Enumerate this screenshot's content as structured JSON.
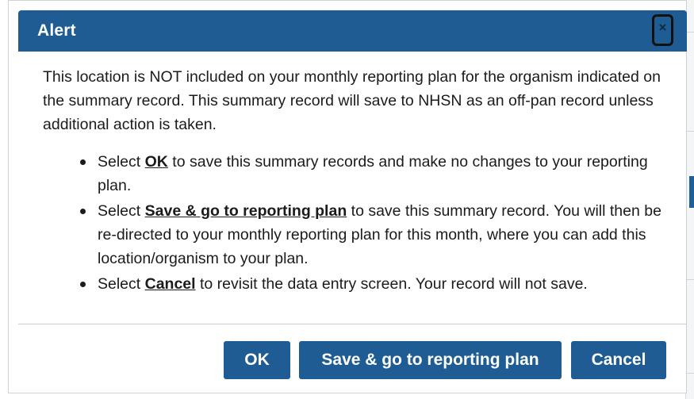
{
  "dialog": {
    "title": "Alert",
    "close_glyph": "×",
    "message": "This location is NOT included on your monthly reporting plan for the organism indicated on the summary record. This summary record will save to NHSN as an off-pan record unless additional action is taken.",
    "bullets": [
      {
        "lead": "Select ",
        "keyword": "OK",
        "rest": " to save this summary records and make no changes to your reporting plan."
      },
      {
        "lead": "Select ",
        "keyword": "Save & go to reporting plan",
        "rest": " to save this summary record. You will then be re-directed to your monthly reporting plan for this month, where you can add this location/organism to your plan."
      },
      {
        "lead": "Select ",
        "keyword": "Cancel",
        "rest": " to revisit the data entry screen. Your record will not save."
      }
    ],
    "buttons": {
      "ok": "OK",
      "save": "Save & go to reporting plan",
      "cancel": "Cancel"
    }
  },
  "colors": {
    "titlebar": "#1e5c93",
    "button": "#1e5c93",
    "text": "#1b1b1b"
  }
}
